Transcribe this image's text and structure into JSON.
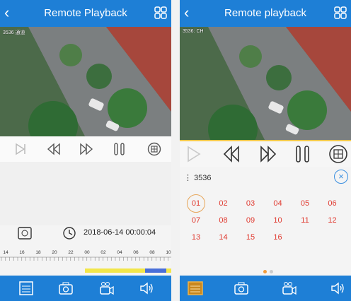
{
  "left": {
    "header": {
      "back_icon": "chevron-left-icon",
      "title": "Remote Playback",
      "layout_icon": "grid-icon"
    },
    "video": {
      "osd": "3536 通道"
    },
    "controls": [
      "step-icon",
      "rewind-icon",
      "fast-forward-icon",
      "pause-icon",
      "split-screen-icon"
    ],
    "date_time": "2018-06-14 00:00:04",
    "time_labels": [
      "14",
      "16",
      "18",
      "20",
      "22",
      "00",
      "02",
      "04",
      "06",
      "08",
      "10"
    ],
    "bottom": [
      "channel-list-icon",
      "camera-icon",
      "record-icon",
      "volume-icon"
    ]
  },
  "right": {
    "header": {
      "back_icon": "chevron-left-icon",
      "title": "Remote playback",
      "layout_icon": "grid-icon"
    },
    "video": {
      "osd": "3536: CH"
    },
    "channel_label": "3536",
    "close": "×",
    "numbers": [
      "01",
      "02",
      "03",
      "04",
      "05",
      "06",
      "07",
      "08",
      "09",
      "10",
      "11",
      "12",
      "13",
      "14",
      "15",
      "16"
    ],
    "selected": "01",
    "bottom": [
      "channel-list-icon",
      "camera-icon",
      "record-icon",
      "volume-icon"
    ]
  },
  "colors": {
    "brand": "#1e7fd6",
    "number": "#e0392f",
    "highlight": "#f2c94c"
  }
}
